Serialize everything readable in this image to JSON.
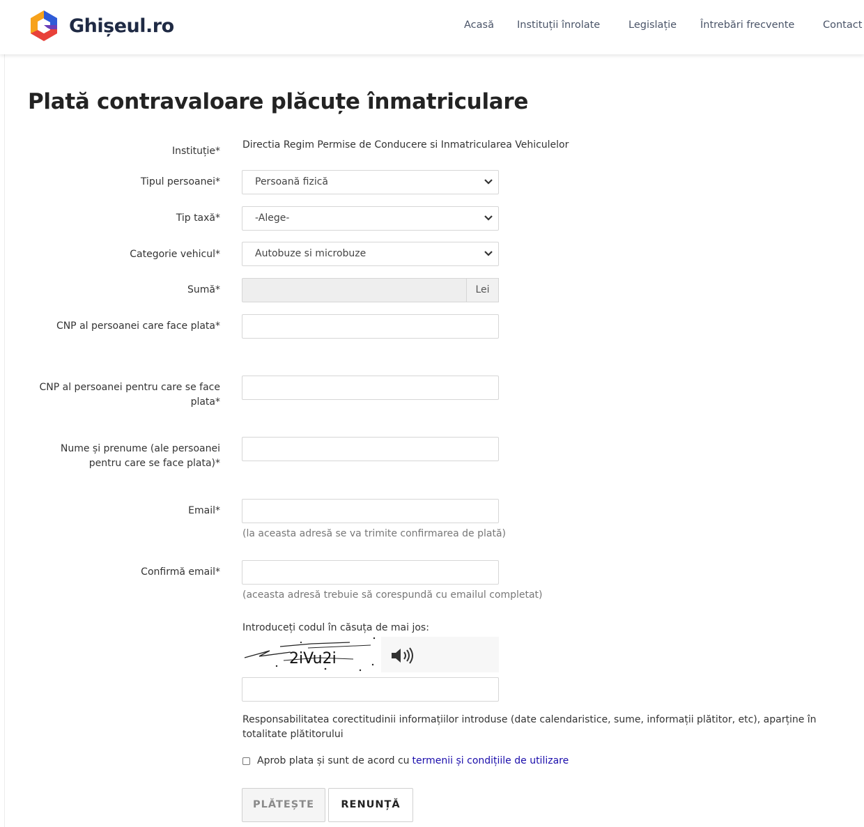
{
  "brand": {
    "name": "Ghișeul.ro",
    "colors": {
      "blue": "#2f5bd7",
      "orange": "#f7a21b",
      "red": "#e8413a",
      "purple": "#6b3fb8",
      "text": "#1f2a44"
    }
  },
  "nav": {
    "items": [
      {
        "label": "Acasă"
      },
      {
        "label": "Instituții înrolate"
      },
      {
        "label": "Legislație"
      },
      {
        "label": "Întrebări frecvente"
      },
      {
        "label": "Contact"
      }
    ]
  },
  "page": {
    "title": "Plată contravaloare plăcuțe înmatriculare"
  },
  "form": {
    "institution": {
      "label": "Instituție*",
      "value": "Directia Regim Permise de Conducere si Inmatricularea Vehiculelor"
    },
    "person_type": {
      "label": "Tipul persoanei*",
      "selected": "Persoană fizică"
    },
    "tax_type": {
      "label": "Tip taxă*",
      "selected": "-Alege-"
    },
    "vehicle_category": {
      "label": "Categorie vehicul*",
      "selected": "Autobuze si microbuze"
    },
    "amount": {
      "label": "Sumă*",
      "value": "",
      "currency": "Lei"
    },
    "payer_cnp": {
      "label": "CNP al persoanei care face plata*",
      "value": ""
    },
    "beneficiary_cnp": {
      "label": "CNP al persoanei pentru care se face plata*",
      "value": ""
    },
    "beneficiary_name": {
      "label": "Nume și prenume (ale persoanei pentru care se face plata)*",
      "value": ""
    },
    "email": {
      "label": "Email*",
      "value": "",
      "hint": "(la aceasta adresă se va trimite confirmarea de plată)"
    },
    "email_confirm": {
      "label": "Confirmă email*",
      "value": "",
      "hint": "(aceasta adresă trebuie să corespundă cu emailul completat)"
    },
    "captcha": {
      "label": "Introduceți codul în căsuța de mai jos:",
      "code": "2iVu2i",
      "value": ""
    },
    "disclaimer": "Responsabilitatea corectitudinii informațiilor introduse (date calendaristice, sume, informații plătitor, etc), aparține în totalitate plătitorului",
    "agree": {
      "text": "Aprob plata și sunt de acord cu",
      "link": "termenii și condițiile de utilizare",
      "checked": false
    }
  },
  "buttons": {
    "pay": "PLĂTEȘTE",
    "cancel": "RENUNȚĂ"
  }
}
